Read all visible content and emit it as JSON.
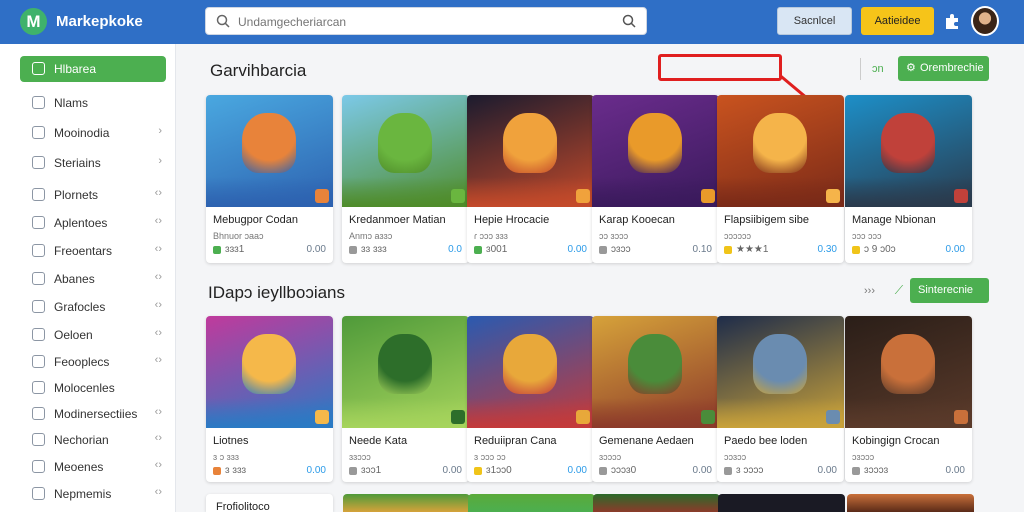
{
  "app": {
    "logo_letter": "M",
    "brand": "Markepkoke",
    "search_placeholder": "Undamgecheriarcan",
    "secondary_button": "Sacnlcel",
    "primary_button": "Aatieidee"
  },
  "sidebar": {
    "items": [
      {
        "label": "Hlbarea",
        "icon": "home-icon",
        "chevron": "",
        "active": true
      },
      {
        "label": "Nlams",
        "icon": "apps-icon",
        "chevron": ""
      },
      {
        "label": "Mooinodia",
        "icon": "media-icon",
        "chevron": "›"
      },
      {
        "label": "Steriains",
        "icon": "star-folder-icon",
        "chevron": "›"
      },
      {
        "label": "Plornets",
        "icon": "planet-icon",
        "chevron": "‹›"
      },
      {
        "label": "Aplentoes",
        "icon": "list-icon",
        "chevron": "‹›"
      },
      {
        "label": "Freoentars",
        "icon": "grid-icon",
        "chevron": "‹›"
      },
      {
        "label": "Abanes",
        "icon": "clock-icon",
        "chevron": "‹›"
      },
      {
        "label": "Grafocles",
        "icon": "square-icon",
        "chevron": "‹›"
      },
      {
        "label": "Oeloen",
        "icon": "check-icon",
        "chevron": "‹›"
      },
      {
        "label": "Feooplecs",
        "icon": "circle-icon",
        "chevron": "‹›"
      },
      {
        "label": "Molocenles",
        "icon": "shield-icon",
        "chevron": ""
      },
      {
        "label": "Modinersectiies",
        "icon": "tag-icon",
        "chevron": "‹›"
      },
      {
        "label": "Nechorian",
        "icon": "info-icon",
        "chevron": "‹›"
      },
      {
        "label": "Meoenes",
        "icon": "bell-icon",
        "chevron": "‹›"
      },
      {
        "label": "Nepmemis",
        "icon": "settings-icon",
        "chevron": "‹›"
      }
    ]
  },
  "section1": {
    "title": "Garvihbarcia",
    "link": "ɔn",
    "button": "Orembrechie",
    "cards": [
      {
        "title": "Mebugpor Codan",
        "meta": "Bhnuor ɔaaɔ",
        "rating": "ɜɜɜ1",
        "price": "0.00",
        "price_color": "#6a7a8c",
        "dot": "#4caf50",
        "c1": "#4aa8e0",
        "c2": "#e8833a",
        "c3": "#2d62b0"
      },
      {
        "title": "Kredanmoer Matian",
        "meta": "Anmɔ aɜɜɔ",
        "rating": "ɜɜ ɜɜɜ",
        "price": "0.0",
        "price_color": "#2c9be8",
        "dot": "#999",
        "c1": "#7cc9e8",
        "c2": "#6ab63f",
        "c3": "#4f8c2a"
      },
      {
        "title": "Hepie Hrocacie",
        "meta": "ɾ ɔɔɔ ɜɜɜ",
        "rating": "ɜ001",
        "price": "0.00",
        "price_color": "#2c9be8",
        "dot": "#4caf50",
        "c1": "#1b1b2e",
        "c2": "#f0a23c",
        "c3": "#c44a2a"
      },
      {
        "title": "Karap Kooecan",
        "meta": "ɔɔ ɜɔɔɔ",
        "rating": "ɔɜɔɔ",
        "price": "0.10",
        "price_color": "#6a7a8c",
        "dot": "#999",
        "c1": "#6a2c8c",
        "c2": "#e99a2a",
        "c3": "#3a1a5c"
      },
      {
        "title": "Flapsiibigem sibe",
        "meta": "ɔɔɔɔɔɔ",
        "rating": "★★★1",
        "price": "0.30",
        "price_color": "#2c9be8",
        "dot": "#f0c419",
        "c1": "#c9531f",
        "c2": "#f5b44a",
        "c3": "#7a2a18"
      },
      {
        "title": "Manage Nbionan",
        "meta": "ɔɔɔ ɔɔɔ",
        "rating": "ɔ 9 ɔ0ɔ",
        "price": "0.00",
        "price_color": "#2c9be8",
        "dot": "#f0c419",
        "c1": "#1d8fc8",
        "c2": "#c0413a",
        "c3": "#2a3a4c"
      }
    ]
  },
  "section2": {
    "title": "IDapɔ ieyllboɔians",
    "button": "Sinterecnie",
    "cards": [
      {
        "title": "Liotnes",
        "meta": "ɜ ɔ ɜɜɜ",
        "rating": "ɜ ɜɜɜ",
        "price": "0.00",
        "price_color": "#2c9be8",
        "dot": "#e8833a",
        "c1": "#c03a9c",
        "c2": "#f5b84a",
        "c3": "#2a7ac4"
      },
      {
        "title": "Neede Kata",
        "meta": "ɜɜɔɔɔ",
        "rating": "ɜɔɔ1",
        "price": "0.00",
        "price_color": "#6a7a8c",
        "dot": "#999",
        "c1": "#4f9a3a",
        "c2": "#2d6e2a",
        "c3": "#a6d45c"
      },
      {
        "title": "Reduiipran Cana",
        "meta": "ɜ ɔɔɔ ɔɔ",
        "rating": "ɜ1ɔɔ0",
        "price": "0.00",
        "price_color": "#2c9be8",
        "dot": "#f0c419",
        "c1": "#2a5ab0",
        "c2": "#e8a83a",
        "c3": "#c43a3a"
      },
      {
        "title": "Gemenane Aedaen",
        "meta": "ɜɔɔɔɔ",
        "rating": "ɔɔɔɜ0",
        "price": "0.00",
        "price_color": "#6a7a8c",
        "dot": "#999",
        "c1": "#d6a23a",
        "c2": "#4a8c3a",
        "c3": "#8c3a2a"
      },
      {
        "title": "Paedo bee loden",
        "meta": "ɔɔɜɔɔ",
        "rating": "ɜ ɔɔɔɔ",
        "price": "0.00",
        "price_color": "#6a7a8c",
        "dot": "#999",
        "c1": "#1e2c4a",
        "c2": "#6a8cb0",
        "c3": "#c9a23a"
      },
      {
        "title": "Kobingign Crocan",
        "meta": "ɔɜɔɔɔ",
        "rating": "ɜɔɔɔɜ",
        "price": "0.00",
        "price_color": "#6a7a8c",
        "dot": "#999",
        "c1": "#2a1e18",
        "c2": "#c9703a",
        "c3": "#5a3a2a"
      }
    ]
  },
  "peek": {
    "title": "Frofiolitoco"
  },
  "colors": {
    "topbar": "#2f6fc6",
    "accent": "#4caf50",
    "primary_button": "#f6c419",
    "annotation": "#e01f1f"
  }
}
